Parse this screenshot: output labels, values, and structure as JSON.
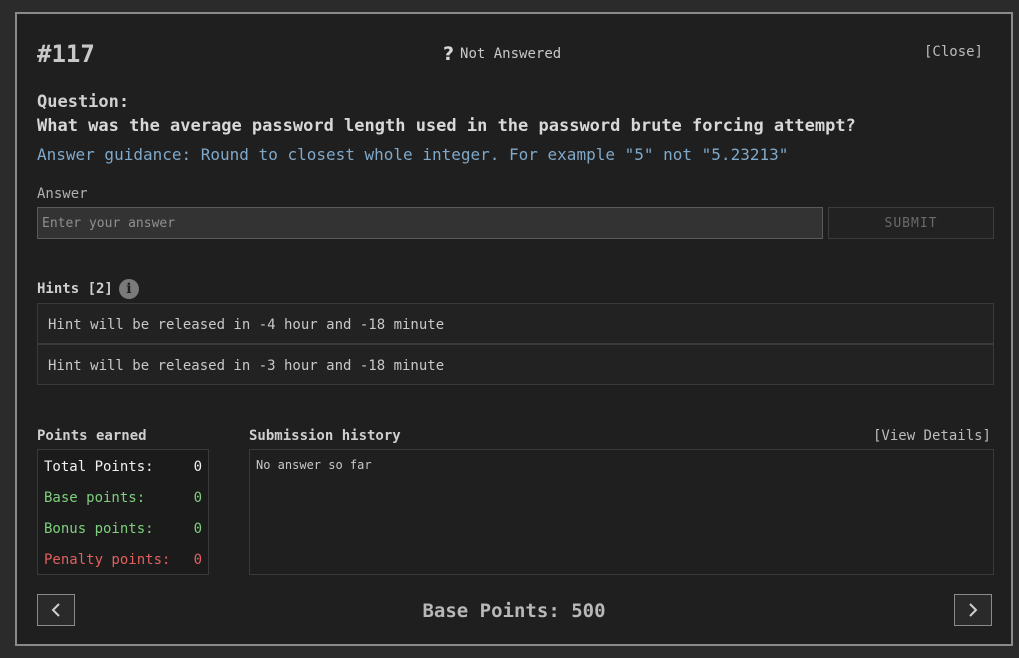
{
  "header": {
    "question_id": "#117",
    "status_icon": "question-mark-icon",
    "status_glyph": "?",
    "status_text": "Not Answered",
    "close_label": "[Close]"
  },
  "question": {
    "label": "Question:",
    "text": "What was the average password length used in the password brute forcing attempt?",
    "guidance": "Answer guidance: Round to closest whole integer. For example \"5\" not \"5.23213\""
  },
  "answer": {
    "label": "Answer",
    "placeholder": "Enter your answer",
    "value": "",
    "submit_label": "SUBMIT"
  },
  "hints": {
    "title": "Hints [2]",
    "info_icon": "info-icon",
    "items": [
      "Hint will be released in -4 hour and -18 minute",
      "Hint will be released in -3 hour and -18 minute"
    ]
  },
  "points_earned": {
    "title": "Points earned",
    "total_label": "Total Points:",
    "total_value": "0",
    "base_label": "Base points:",
    "base_value": "0",
    "bonus_label": "Bonus points:",
    "bonus_value": "0",
    "penalty_label": "Penalty points:",
    "penalty_value": "0"
  },
  "submission_history": {
    "title": "Submission history",
    "view_details_label": "[View Details]",
    "empty_text": "No answer so far"
  },
  "footer": {
    "base_points_text": "Base Points: 500",
    "prev_icon": "chevron-left-icon",
    "next_icon": "chevron-right-icon"
  },
  "colors": {
    "background": "#1f1f1f",
    "guidance": "#7fa8c9",
    "positive": "#7ecf7e",
    "penalty": "#e06060"
  }
}
